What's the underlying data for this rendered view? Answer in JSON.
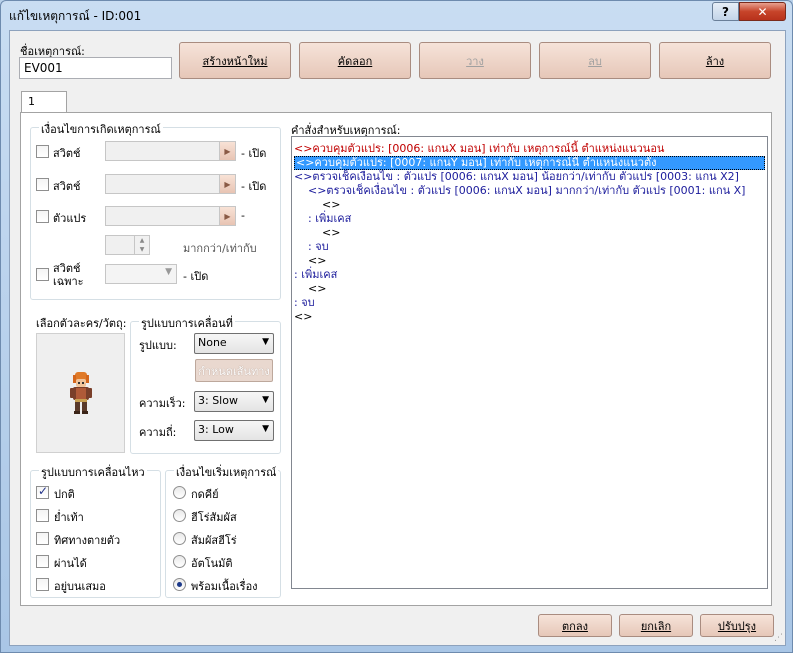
{
  "window": {
    "title": "แก้ไขเหตุการณ์ - ID:001",
    "help_label": "?",
    "close_label": "✕"
  },
  "event_name": {
    "label": "ชื่อเหตุการณ์:",
    "value": "EV001"
  },
  "toolbar": {
    "new_page": "สร้างหน้าใหม่",
    "copy": "คัดลอก",
    "paste": "วาง",
    "delete": "ลบ",
    "clear": "ล้าง"
  },
  "tab": {
    "label": "1"
  },
  "conditions": {
    "title": "เงื่อนไขการเกิดเหตุการณ์",
    "switch1": {
      "label": "สวิตช์",
      "suffix": "- เปิด"
    },
    "switch2": {
      "label": "สวิตช์",
      "suffix": "- เปิด"
    },
    "variable": {
      "label": "ตัวแปร",
      "suffix": "-",
      "compare": "มากกว่า/เท่ากับ"
    },
    "self_switch": {
      "label_line1": "สวิตช์",
      "label_line2": "เฉพาะ",
      "suffix": "- เปิด"
    }
  },
  "graphic": {
    "label": "เลือกตัวละคร/วัตถุ:"
  },
  "movement": {
    "title": "รูปแบบการเคลื่อนที่",
    "type_label": "รูปแบบ:",
    "type_value": "None",
    "route_button": "กำหนดเส้นทาง",
    "speed_label": "ความเร็ว:",
    "speed_value": "3: Slow",
    "freq_label": "ความถี่:",
    "freq_value": "3: Low"
  },
  "options": {
    "title": "รูปแบบการเคลื่อนไหว",
    "items": [
      {
        "label": "ปกติ",
        "checked": true
      },
      {
        "label": "ย่ำเท้า",
        "checked": false
      },
      {
        "label": "ทิศทางตายตัว",
        "checked": false
      },
      {
        "label": "ผ่านได้",
        "checked": false
      },
      {
        "label": "อยู่บนเสมอ",
        "checked": false
      }
    ]
  },
  "trigger": {
    "title": "เงื่อนไขเริ่มเหตุการณ์",
    "items": [
      {
        "label": "กดคีย์",
        "checked": false
      },
      {
        "label": "ฮีโร่สัมผัส",
        "checked": false
      },
      {
        "label": "สัมผัสฮีโร่",
        "checked": false
      },
      {
        "label": "อัตโนมัติ",
        "checked": false
      },
      {
        "label": "พร้อมเนื้อเรื่อง",
        "checked": true
      }
    ]
  },
  "commands": {
    "label": "คำสั่งสำหรับเหตุการณ์:",
    "lines": [
      {
        "text": "<>ควบคุมตัวแปร: [0006: แกนX มอน] เท่ากับ เหตุการณ์นี้ ตำแหน่งแนวนอน",
        "style": "red",
        "indent": 0
      },
      {
        "text": "<>ควบคุมตัวแปร: [0007: แกนY มอน] เท่ากับ เหตุการณ์นี้ ตำแหน่งแนวตั้ง",
        "style": "sel",
        "indent": 0
      },
      {
        "text": "<>ตรวจเช็คเงื่อนไข : ตัวแปร [0006: แกนX มอน] น้อยกว่า/เท่ากับ ตัวแปร [0003: แกน X2]",
        "style": "blue",
        "indent": 0
      },
      {
        "text": "<>ตรวจเช็คเงื่อนไข : ตัวแปร [0006: แกนX มอน] มากกว่า/เท่ากับ ตัวแปร [0001: แกน X]",
        "style": "blue",
        "indent": 1
      },
      {
        "text": "<>",
        "style": "black",
        "indent": 2
      },
      {
        "text": ":  เพิ่มเคส",
        "style": "blue",
        "indent": 1
      },
      {
        "text": "<>",
        "style": "black",
        "indent": 2
      },
      {
        "text": ":  จบ",
        "style": "blue",
        "indent": 1
      },
      {
        "text": "<>",
        "style": "black",
        "indent": 1
      },
      {
        "text": ":  เพิ่มเคส",
        "style": "blue",
        "indent": 0
      },
      {
        "text": "<>",
        "style": "black",
        "indent": 1
      },
      {
        "text": ":  จบ",
        "style": "blue",
        "indent": 0
      },
      {
        "text": "<>",
        "style": "black",
        "indent": 0
      }
    ]
  },
  "footer": {
    "ok": "ตกลง",
    "cancel": "ยกเลิก",
    "apply": "ปรับปรุง"
  },
  "colors": {
    "command_red": "#c00000",
    "command_blue": "#1c1c9c",
    "selection": "#3399ff",
    "button_face": "#f6e3d9"
  }
}
